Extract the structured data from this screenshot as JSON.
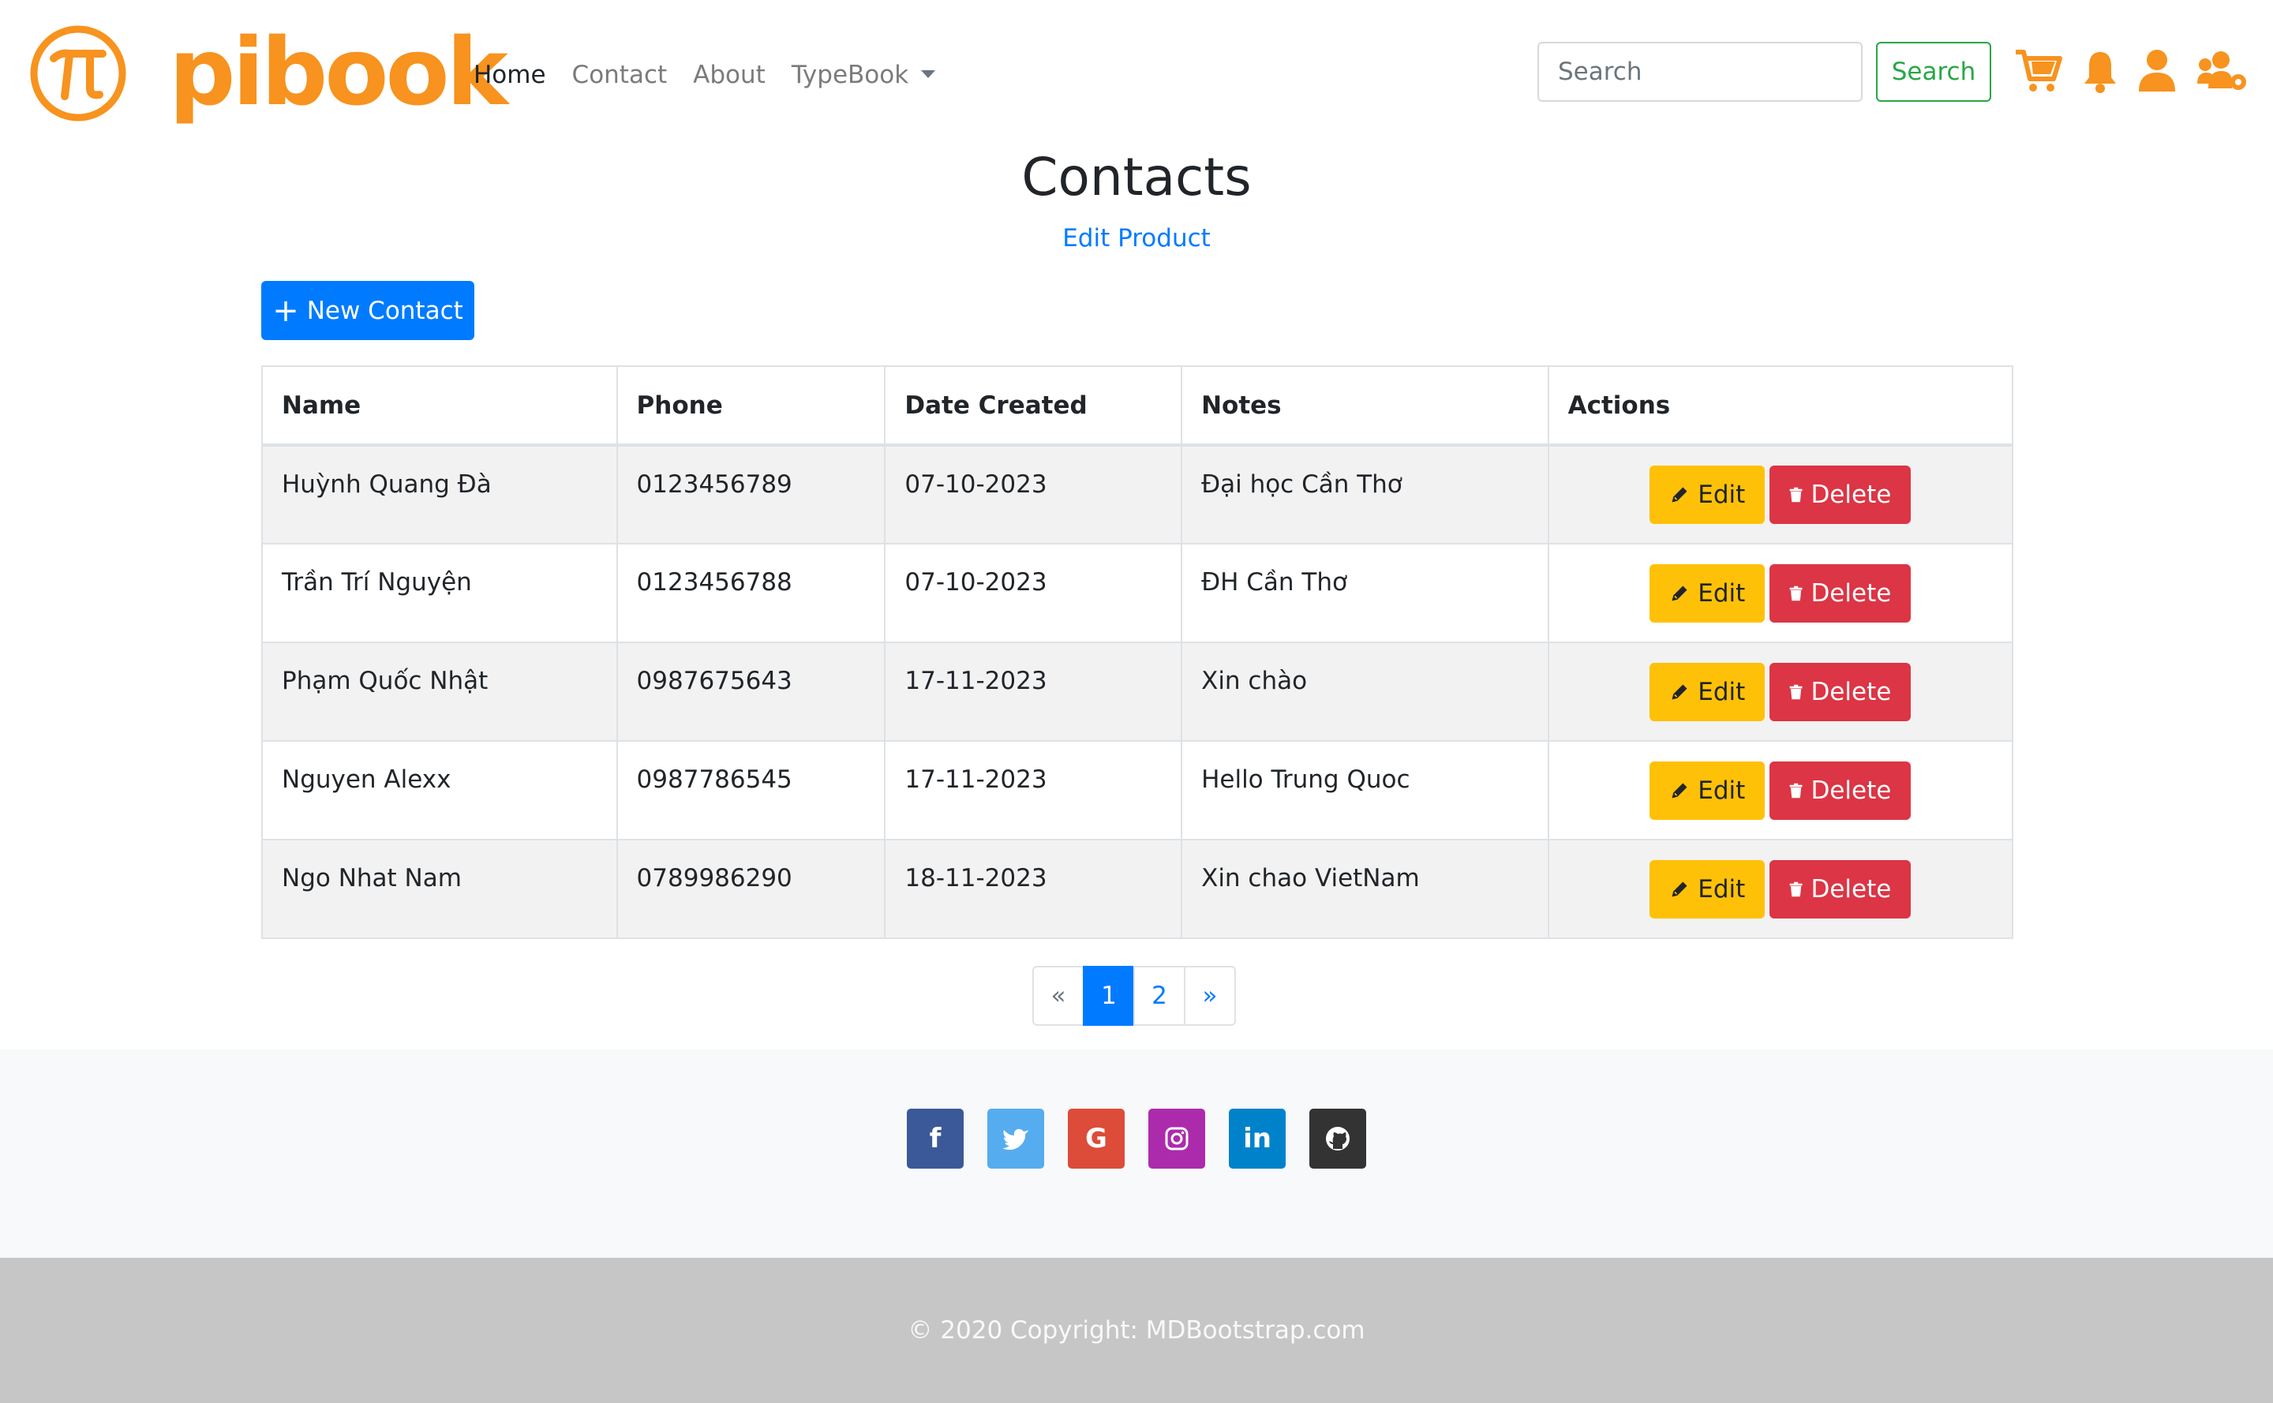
{
  "brand": {
    "name": "pibook",
    "symbol": "π",
    "color": "#f7931e"
  },
  "nav": {
    "links": [
      {
        "label": "Home",
        "active": true
      },
      {
        "label": "Contact",
        "active": false
      },
      {
        "label": "About",
        "active": false
      },
      {
        "label": "TypeBook",
        "active": false,
        "dropdown": true
      }
    ],
    "search_placeholder": "Search",
    "search_button": "Search",
    "icons": [
      "cart-icon",
      "bell-icon",
      "user-icon",
      "users-cog-icon"
    ],
    "icon_color": "#f7931e"
  },
  "page": {
    "title": "Contacts",
    "sub_link": "Edit Product",
    "new_button": "New Contact"
  },
  "table": {
    "headers": [
      "Name",
      "Phone",
      "Date Created",
      "Notes",
      "Actions"
    ],
    "rows": [
      {
        "name": "Huỳnh Quang Đà",
        "phone": "0123456789",
        "date": "07-10-2023",
        "notes": "Đại học Cần Thơ"
      },
      {
        "name": "Trần Trí Nguyện",
        "phone": "0123456788",
        "date": "07-10-2023",
        "notes": "ĐH Cần Thơ"
      },
      {
        "name": "Phạm Quốc Nhật",
        "phone": "0987675643",
        "date": "17-11-2023",
        "notes": "Xin chào"
      },
      {
        "name": "Nguyen Alexx",
        "phone": "0987786545",
        "date": "17-11-2023",
        "notes": "Hello Trung Quoc"
      },
      {
        "name": "Ngo Nhat Nam",
        "phone": "0789986290",
        "date": "18-11-2023",
        "notes": "Xin chao VietNam"
      }
    ],
    "edit_label": "Edit",
    "delete_label": "Delete"
  },
  "pagination": {
    "prev": "«",
    "pages": [
      "1",
      "2"
    ],
    "current": "1",
    "next": "»"
  },
  "footer": {
    "social": [
      {
        "name": "facebook",
        "glyph": "f",
        "color": "#3b5998"
      },
      {
        "name": "twitter",
        "glyph": "t",
        "color": "#55acee"
      },
      {
        "name": "google",
        "glyph": "G",
        "color": "#dd4b39"
      },
      {
        "name": "instagram",
        "glyph": "◎",
        "color": "#ac2bac"
      },
      {
        "name": "linkedin",
        "glyph": "in",
        "color": "#0082ca"
      },
      {
        "name": "github",
        "glyph": "⬤",
        "color": "#333333"
      }
    ],
    "copyright": "© 2020 Copyright: MDBootstrap.com"
  }
}
